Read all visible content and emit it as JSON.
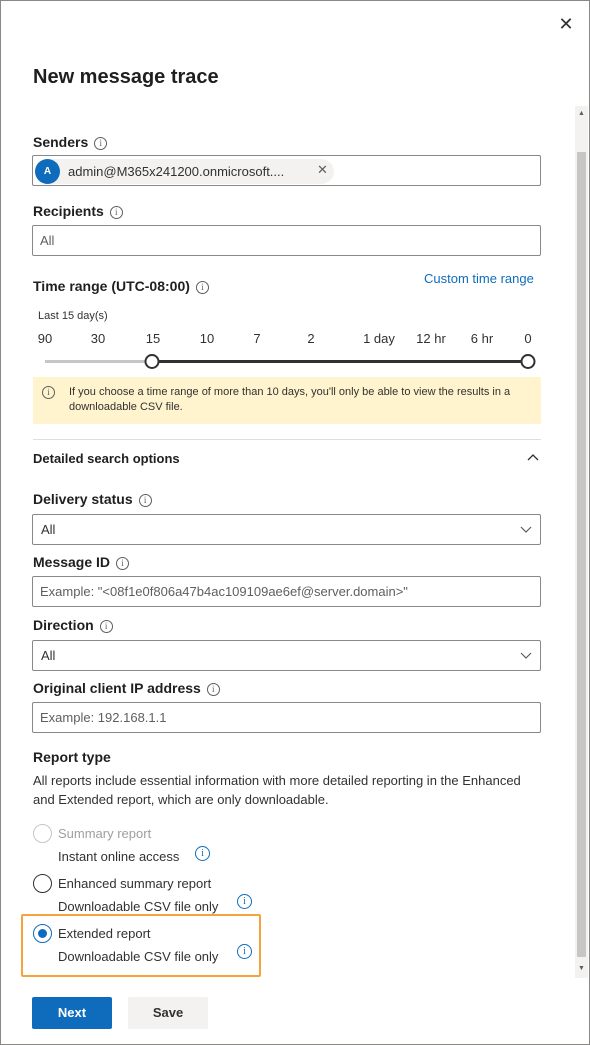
{
  "panel": {
    "title": "New message trace",
    "close_glyph": "✕"
  },
  "senders": {
    "label": "Senders",
    "chip": {
      "initial": "A",
      "text": "admin@M365x241200.onmicrosoft....",
      "remove_glyph": "✕"
    }
  },
  "recipients": {
    "label": "Recipients",
    "placeholder": "All"
  },
  "time_range": {
    "label": "Time range (UTC-08:00)",
    "custom_link": "Custom time range",
    "selected_caption": "Last 15 day(s)",
    "ticks": [
      "90",
      "30",
      "15",
      "10",
      "7",
      "2",
      "1 day",
      "12 hr",
      "6 hr",
      "0"
    ],
    "selected_from": "15",
    "selected_to": "0"
  },
  "warning": {
    "text": "If you choose a time range of more than 10 days, you'll only be able to view the results in a downloadable CSV file."
  },
  "detailed": {
    "title": "Detailed search options",
    "delivery_status": {
      "label": "Delivery status",
      "value": "All"
    },
    "message_id": {
      "label": "Message ID",
      "placeholder": "Example: \"<08f1e0f806a47b4ac109109ae6ef@server.domain>\""
    },
    "direction": {
      "label": "Direction",
      "value": "All"
    },
    "client_ip": {
      "label": "Original client IP address",
      "placeholder": "Example: 192.168.1.1"
    }
  },
  "report_type": {
    "label": "Report type",
    "description": "All reports include essential information with more detailed reporting in the Enhanced and Extended report, which are only downloadable.",
    "options": [
      {
        "label": "Summary report",
        "sub": "Instant online access",
        "state": "disabled"
      },
      {
        "label": "Enhanced summary report",
        "sub": "Downloadable CSV file only",
        "state": "unchecked"
      },
      {
        "label": "Extended report",
        "sub": "Downloadable CSV file only",
        "state": "checked"
      }
    ]
  },
  "footer": {
    "next_label": "Next",
    "save_label": "Save"
  },
  "colors": {
    "accent": "#0f6cbd",
    "warning_bg": "#fff4ce",
    "highlight": "#f7a33b"
  },
  "icons": {
    "info": "info-icon",
    "chevron_down": "chevron-down-icon",
    "chevron_up": "chevron-up-icon",
    "close": "close-icon"
  }
}
